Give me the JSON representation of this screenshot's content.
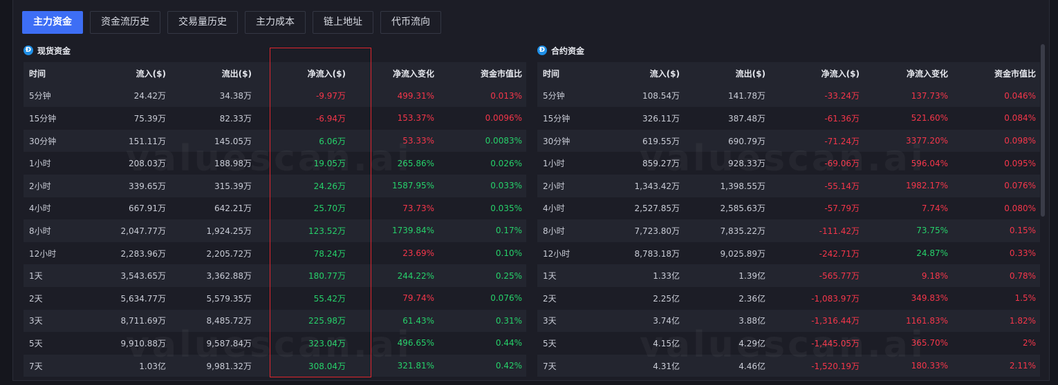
{
  "tabs": [
    {
      "label": "主力资金",
      "active": true
    },
    {
      "label": "资金流历史",
      "active": false
    },
    {
      "label": "交易量历史",
      "active": false
    },
    {
      "label": "主力成本",
      "active": false
    },
    {
      "label": "链上地址",
      "active": false
    },
    {
      "label": "代币流向",
      "active": false
    }
  ],
  "spot": {
    "title": "现货资金",
    "headers": [
      "时间",
      "流入($)",
      "流出($)",
      "净流入($)",
      "净流入变化",
      "资金市值比"
    ],
    "rows": [
      {
        "time": "5分钟",
        "inflow": "24.42万",
        "outflow": "34.38万",
        "net": "-9.97万",
        "net_color": "red",
        "change": "499.31%",
        "change_color": "red",
        "ratio": "0.013%",
        "ratio_color": "red"
      },
      {
        "time": "15分钟",
        "inflow": "75.39万",
        "outflow": "82.33万",
        "net": "-6.94万",
        "net_color": "red",
        "change": "153.37%",
        "change_color": "red",
        "ratio": "0.0096%",
        "ratio_color": "red"
      },
      {
        "time": "30分钟",
        "inflow": "151.11万",
        "outflow": "145.05万",
        "net": "6.06万",
        "net_color": "green",
        "change": "53.33%",
        "change_color": "red",
        "ratio": "0.0083%",
        "ratio_color": "green"
      },
      {
        "time": "1小时",
        "inflow": "208.03万",
        "outflow": "188.98万",
        "net": "19.05万",
        "net_color": "green",
        "change": "265.86%",
        "change_color": "green",
        "ratio": "0.026%",
        "ratio_color": "green"
      },
      {
        "time": "2小时",
        "inflow": "339.65万",
        "outflow": "315.39万",
        "net": "24.26万",
        "net_color": "green",
        "change": "1587.95%",
        "change_color": "green",
        "ratio": "0.033%",
        "ratio_color": "green"
      },
      {
        "time": "4小时",
        "inflow": "667.91万",
        "outflow": "642.21万",
        "net": "25.70万",
        "net_color": "green",
        "change": "73.73%",
        "change_color": "red",
        "ratio": "0.035%",
        "ratio_color": "green"
      },
      {
        "time": "8小时",
        "inflow": "2,047.77万",
        "outflow": "1,924.25万",
        "net": "123.52万",
        "net_color": "green",
        "change": "1739.84%",
        "change_color": "green",
        "ratio": "0.17%",
        "ratio_color": "green"
      },
      {
        "time": "12小时",
        "inflow": "2,283.96万",
        "outflow": "2,205.72万",
        "net": "78.24万",
        "net_color": "green",
        "change": "23.69%",
        "change_color": "red",
        "ratio": "0.10%",
        "ratio_color": "green"
      },
      {
        "time": "1天",
        "inflow": "3,543.65万",
        "outflow": "3,362.88万",
        "net": "180.77万",
        "net_color": "green",
        "change": "244.22%",
        "change_color": "green",
        "ratio": "0.25%",
        "ratio_color": "green"
      },
      {
        "time": "2天",
        "inflow": "5,634.77万",
        "outflow": "5,579.35万",
        "net": "55.42万",
        "net_color": "green",
        "change": "79.74%",
        "change_color": "red",
        "ratio": "0.076%",
        "ratio_color": "green"
      },
      {
        "time": "3天",
        "inflow": "8,711.69万",
        "outflow": "8,485.72万",
        "net": "225.98万",
        "net_color": "green",
        "change": "61.43%",
        "change_color": "green",
        "ratio": "0.31%",
        "ratio_color": "green"
      },
      {
        "time": "5天",
        "inflow": "9,910.88万",
        "outflow": "9,587.84万",
        "net": "323.04万",
        "net_color": "green",
        "change": "496.65%",
        "change_color": "green",
        "ratio": "0.44%",
        "ratio_color": "green"
      },
      {
        "time": "7天",
        "inflow": "1.03亿",
        "outflow": "9,981.32万",
        "net": "308.04万",
        "net_color": "green",
        "change": "321.81%",
        "change_color": "green",
        "ratio": "0.42%",
        "ratio_color": "green"
      }
    ]
  },
  "futures": {
    "title": "合约资金",
    "headers": [
      "时间",
      "流入($)",
      "流出($)",
      "净流入($)",
      "净流入变化",
      "资金市值比"
    ],
    "rows": [
      {
        "time": "5分钟",
        "inflow": "108.54万",
        "outflow": "141.78万",
        "net": "-33.24万",
        "net_color": "red",
        "change": "137.73%",
        "change_color": "red",
        "ratio": "0.046%",
        "ratio_color": "red"
      },
      {
        "time": "15分钟",
        "inflow": "326.11万",
        "outflow": "387.48万",
        "net": "-61.36万",
        "net_color": "red",
        "change": "521.60%",
        "change_color": "red",
        "ratio": "0.084%",
        "ratio_color": "red"
      },
      {
        "time": "30分钟",
        "inflow": "619.55万",
        "outflow": "690.79万",
        "net": "-71.24万",
        "net_color": "red",
        "change": "3377.20%",
        "change_color": "red",
        "ratio": "0.098%",
        "ratio_color": "red"
      },
      {
        "time": "1小时",
        "inflow": "859.27万",
        "outflow": "928.33万",
        "net": "-69.06万",
        "net_color": "red",
        "change": "596.04%",
        "change_color": "red",
        "ratio": "0.095%",
        "ratio_color": "red"
      },
      {
        "time": "2小时",
        "inflow": "1,343.42万",
        "outflow": "1,398.55万",
        "net": "-55.14万",
        "net_color": "red",
        "change": "1982.17%",
        "change_color": "red",
        "ratio": "0.076%",
        "ratio_color": "red"
      },
      {
        "time": "4小时",
        "inflow": "2,527.85万",
        "outflow": "2,585.63万",
        "net": "-57.79万",
        "net_color": "red",
        "change": "7.74%",
        "change_color": "red",
        "ratio": "0.080%",
        "ratio_color": "red"
      },
      {
        "time": "8小时",
        "inflow": "7,723.80万",
        "outflow": "7,835.22万",
        "net": "-111.42万",
        "net_color": "red",
        "change": "73.75%",
        "change_color": "green",
        "ratio": "0.15%",
        "ratio_color": "red"
      },
      {
        "time": "12小时",
        "inflow": "8,783.18万",
        "outflow": "9,025.89万",
        "net": "-242.71万",
        "net_color": "red",
        "change": "24.87%",
        "change_color": "green",
        "ratio": "0.33%",
        "ratio_color": "red"
      },
      {
        "time": "1天",
        "inflow": "1.33亿",
        "outflow": "1.39亿",
        "net": "-565.77万",
        "net_color": "red",
        "change": "9.18%",
        "change_color": "red",
        "ratio": "0.78%",
        "ratio_color": "red"
      },
      {
        "time": "2天",
        "inflow": "2.25亿",
        "outflow": "2.36亿",
        "net": "-1,083.97万",
        "net_color": "red",
        "change": "349.83%",
        "change_color": "red",
        "ratio": "1.5%",
        "ratio_color": "red"
      },
      {
        "time": "3天",
        "inflow": "3.74亿",
        "outflow": "3.88亿",
        "net": "-1,316.44万",
        "net_color": "red",
        "change": "1161.83%",
        "change_color": "red",
        "ratio": "1.82%",
        "ratio_color": "red"
      },
      {
        "time": "5天",
        "inflow": "4.15亿",
        "outflow": "4.29亿",
        "net": "-1,445.05万",
        "net_color": "red",
        "change": "365.70%",
        "change_color": "red",
        "ratio": "2%",
        "ratio_color": "red"
      },
      {
        "time": "7天",
        "inflow": "4.31亿",
        "outflow": "4.46亿",
        "net": "-1,520.19万",
        "net_color": "red",
        "change": "180.33%",
        "change_color": "red",
        "ratio": "2.11%",
        "ratio_color": "red"
      }
    ]
  },
  "watermark": "valuescan.ai",
  "colors": {
    "accent": "#3d6ef5",
    "up": "#26d16a",
    "down": "#f5364a",
    "highlight": "#e0262e"
  }
}
